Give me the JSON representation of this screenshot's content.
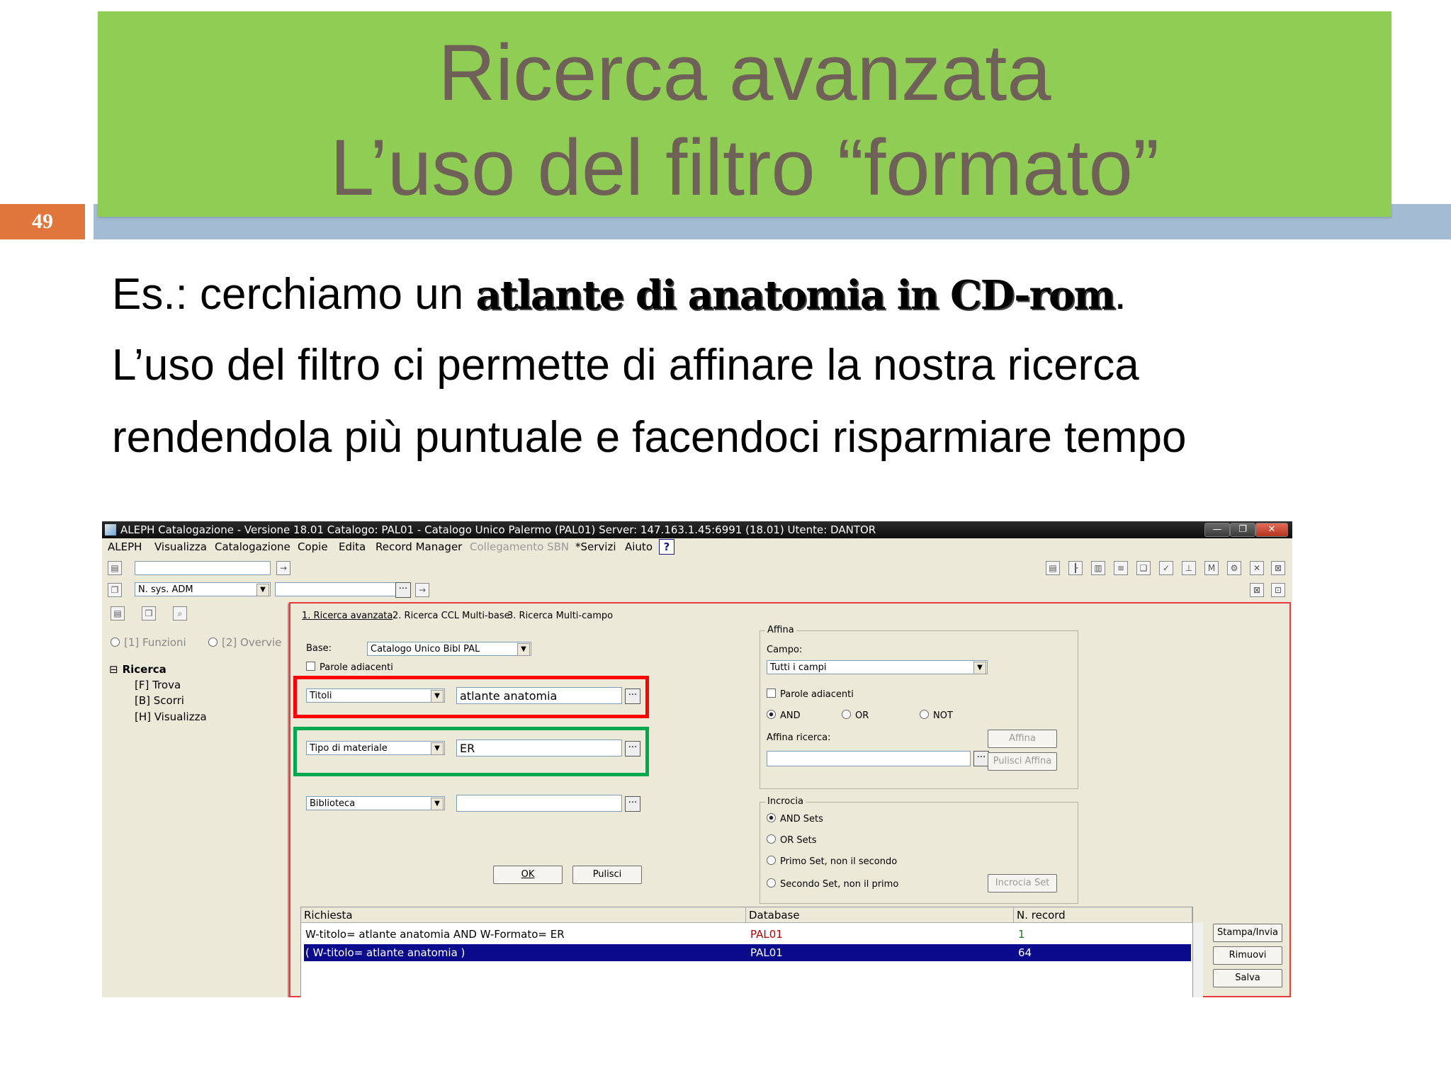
{
  "slide": {
    "title_line1": "Ricerca avanzata",
    "title_line2": "L’uso del filtro “formato”",
    "slide_number": "49",
    "body_line1_prefix": "Es.: cerchiamo un ",
    "body_line1_emphasis": "atlante di anatomia in CD-rom",
    "body_line1_suffix": ".",
    "body_line2": "L’uso del filtro ci permette di affinare la nostra ricerca",
    "body_line3": "rendendola più puntuale e facendoci risparmiare tempo",
    "colors": {
      "title_bg": "#8fcd55",
      "title_text": "#6f6157",
      "band": "#a3bcd3",
      "number_box": "#e0763b",
      "highlight_red": "#ff0000",
      "highlight_green": "#00a84f"
    }
  },
  "app": {
    "title": "ALEPH Catalogazione - Versione 18.01  Catalogo:  PAL01 - Catalogo Unico Palermo (PAL01)  Server:  147.163.1.45:6991 (18.01)  Utente:  DANTOR",
    "menu": [
      "ALEPH",
      "Visualizza",
      "Catalogazione",
      "Copie",
      "Edita",
      "Record Manager",
      "Collegamento SBN",
      "*Servizi",
      "Aiuto"
    ],
    "menu_disabled": "Collegamento SBN",
    "help_icon": "?",
    "toolbar_combo": "N. sys. ADM",
    "dots": "···",
    "left_panel": {
      "radio1": "[1] Funzioni",
      "radio2": "[2] Overvie",
      "tree_root": "Ricerca",
      "tree_items": [
        "[F] Trova",
        "[B] Scorri",
        "[H] Visualizza"
      ]
    },
    "tabs": [
      "1. Ricerca avanzata",
      "2. Ricerca CCL Multi-base",
      "3. Ricerca Multi-campo"
    ],
    "base_label": "Base:",
    "base_value": "Catalogo Unico Bibl PAL",
    "adjacent_words": "Parole adiacenti",
    "row1": {
      "field": "Titoli",
      "value": "atlante anatomia"
    },
    "row2": {
      "field": "Tipo di materiale",
      "value": "ER"
    },
    "row3": {
      "field": "Biblioteca",
      "value": ""
    },
    "operators": [
      "AND",
      "OR",
      "NOT"
    ],
    "ok_button": "OK",
    "clear_button": "Pulisci",
    "affina": {
      "group": "Affina",
      "campo_label": "Campo:",
      "campo_value": "Tutti i campi",
      "adjacent": "Parole adiacenti",
      "operators": [
        "AND",
        "OR",
        "NOT"
      ],
      "ricerca_label": "Affina ricerca:",
      "affina_button": "Affina",
      "clear_button": "Pulisci Affina"
    },
    "incrocia": {
      "group": "Incrocia",
      "options": [
        "AND Sets",
        "OR Sets",
        "Primo Set, non il secondo",
        "Secondo Set, non il primo"
      ],
      "button": "Incrocia Set"
    },
    "results": {
      "headers": [
        "Richiesta",
        "Database",
        "N. record"
      ],
      "rows": [
        {
          "query": "W-titolo= atlante anatomia AND W-Formato= ER",
          "db": "PAL01",
          "count": "1"
        },
        {
          "query": "( W-titolo= atlante anatomia )",
          "db": "PAL01",
          "count": "64"
        }
      ]
    },
    "side_buttons": [
      "Stampa/Invia",
      "Rimuovi",
      "Salva"
    ]
  }
}
